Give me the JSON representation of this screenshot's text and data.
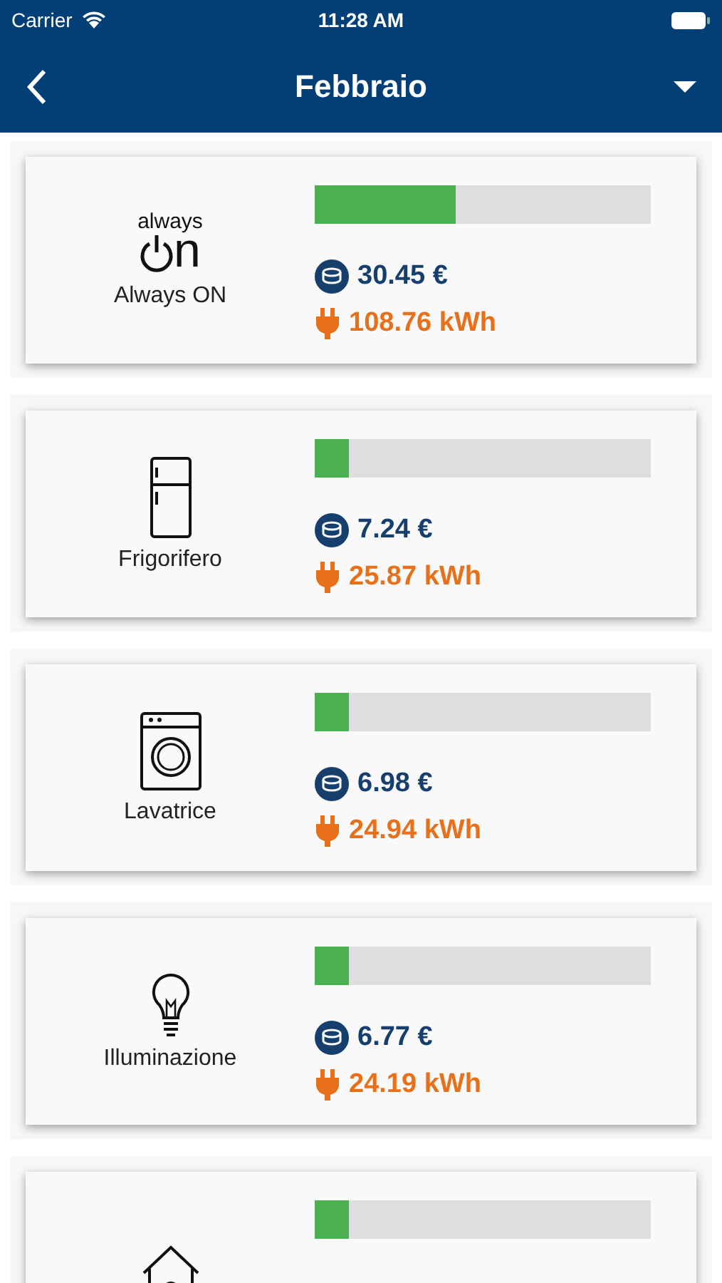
{
  "status_bar": {
    "carrier": "Carrier",
    "time": "11:28 AM"
  },
  "nav_bar": {
    "title": "Febbraio"
  },
  "items": [
    {
      "kind": "always_on",
      "label": "Always ON",
      "logo_top": "always",
      "logo_bottom": "n",
      "level": 0.42,
      "cost": "30.45 €",
      "energy": "108.76 kWh"
    },
    {
      "kind": "fridge",
      "label": "Frigorifero",
      "level": 0.1,
      "cost": "7.24 €",
      "energy": "25.87 kWh"
    },
    {
      "kind": "washer",
      "label": "Lavatrice",
      "level": 0.1,
      "cost": "6.98 €",
      "energy": "24.94 kWh"
    },
    {
      "kind": "bulb",
      "label": "Illuminazione",
      "level": 0.1,
      "cost": "6.77 €",
      "energy": "24.19 kWh"
    },
    {
      "kind": "house",
      "level": 0.1
    }
  ]
}
